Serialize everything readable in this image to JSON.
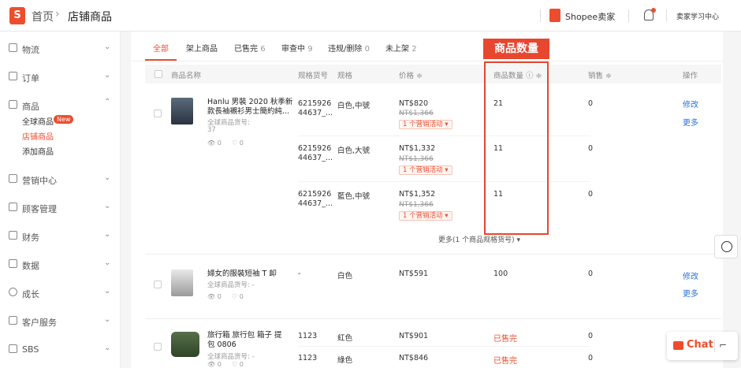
{
  "topbar": {
    "logo": "S",
    "breadcrumb_home": "首页",
    "breadcrumb_sep": "›",
    "breadcrumb_current": "店铺商品",
    "seller_brand": "Shopee卖家",
    "learning_center": "卖家学习中心"
  },
  "sidebar": {
    "items": [
      {
        "label": "物流",
        "icon": "truck-icon"
      },
      {
        "label": "订单",
        "icon": "clipboard-icon"
      },
      {
        "label": "商品",
        "icon": "bag-icon"
      },
      {
        "label": "营销中心",
        "icon": "tag-icon"
      },
      {
        "label": "顾客管理",
        "icon": "user-icon"
      },
      {
        "label": "财务",
        "icon": "wallet-icon"
      },
      {
        "label": "数据",
        "icon": "chart-icon"
      },
      {
        "label": "成长",
        "icon": "growth-icon"
      },
      {
        "label": "客户服务",
        "icon": "service-icon"
      },
      {
        "label": "SBS",
        "icon": "box-icon"
      }
    ],
    "sub_items": [
      "全球商品",
      "店铺商品",
      "添加商品"
    ],
    "new_badge": "New"
  },
  "tabs": [
    {
      "label": "全部",
      "count": ""
    },
    {
      "label": "架上商品",
      "count": ""
    },
    {
      "label": "已售完",
      "count": "6"
    },
    {
      "label": "审查中",
      "count": "9"
    },
    {
      "label": "违规/删除",
      "count": "0"
    },
    {
      "label": "未上架",
      "count": "2"
    }
  ],
  "table": {
    "headers": {
      "name": "商品名称",
      "sku": "规格货号",
      "spec": "规格",
      "price": "价格 ≑",
      "stock": "商品数量 ⓘ ≑",
      "sales": "销售 ≑",
      "ops": "操作"
    },
    "products": [
      {
        "name_line1": "Hanlu 男裝 2020 秋季新",
        "name_line2": "款長袖襯衫男士簡約純...",
        "global_sku_label": "全球商品货号:",
        "global_sku_extra": "37",
        "views": "0",
        "likes": "0",
        "actions": [
          "修改",
          "更多"
        ],
        "variants": [
          {
            "sku1": "6215926",
            "sku2": "44637_...",
            "spec": "白色,中號",
            "price": "NT$820",
            "orig": "NT$1,366",
            "promo": "1 个营销活动 ▾",
            "stock": "21",
            "sales": "0"
          },
          {
            "sku1": "6215926",
            "sku2": "44637_...",
            "spec": "白色,大號",
            "price": "NT$1,332",
            "orig": "NT$1,366",
            "promo": "1 个营销活动 ▾",
            "stock": "11",
            "sales": "0"
          },
          {
            "sku1": "6215926",
            "sku2": "44637_...",
            "spec": "藍色,中號",
            "price": "NT$1,352",
            "orig": "NT$1,366",
            "promo": "1 个营销活动 ▾",
            "stock": "11",
            "sales": "0"
          }
        ],
        "more_variants": "更多(1 个商品规格货号) ▾"
      },
      {
        "name_line1": "婦女的服裝短袖 T 卹",
        "global_sku_label": "全球商品货号: -",
        "views": "0",
        "likes": "0",
        "actions": [
          "修改",
          "更多"
        ],
        "variants": [
          {
            "sku1": "-",
            "spec": "白色",
            "price": "NT$591",
            "stock": "100",
            "sales": "0"
          }
        ]
      },
      {
        "name_line1": "旅行箱 旅行包 箱子 提",
        "name_line2": "包 0806",
        "global_sku_label": "全球商品货号: -",
        "views": "0",
        "likes": "0",
        "variants": [
          {
            "sku1": "1123",
            "spec": "紅色",
            "price": "NT$901",
            "stock": "已售完",
            "sales": "0"
          },
          {
            "sku1": "1123",
            "spec": "綠色",
            "price": "NT$846",
            "stock": "已售完",
            "sales": "0"
          }
        ]
      }
    ]
  },
  "callout": {
    "label": "商品数量"
  },
  "chat": {
    "label": "Chat",
    "minimize": "⌐"
  },
  "colors": {
    "brand": "#ee4d2d",
    "link": "#2673dd",
    "callout": "#e8462e"
  }
}
